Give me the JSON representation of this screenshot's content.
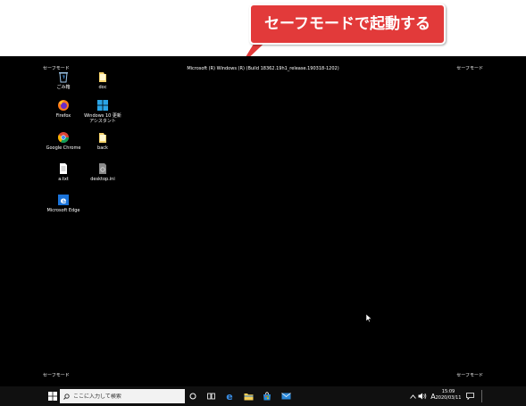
{
  "callout": {
    "text": "セーフモードで起動する"
  },
  "desktop": {
    "build_info": "Microsoft (R) Windows (R) (Build 18362.19h1_release.190318-1202)",
    "corner_labels": {
      "top_left": "セーフモード",
      "top_right": "セーフモード",
      "bottom_left": "セーフモード",
      "bottom_right": "セーフモード"
    },
    "icons": [
      {
        "label": "ごみ箱",
        "icon": "recycle-bin-icon"
      },
      {
        "label": "doc",
        "icon": "folder-icon"
      },
      {
        "label": "Firefox",
        "icon": "firefox-icon"
      },
      {
        "label": "Windows 10 更新アシスタント",
        "icon": "windows-update-assistant-icon"
      },
      {
        "label": "Google Chrome",
        "icon": "chrome-icon"
      },
      {
        "label": "back",
        "icon": "folder-icon"
      },
      {
        "label": "a.txt",
        "icon": "text-file-icon"
      },
      {
        "label": "desktop.ini",
        "icon": "settings-file-icon"
      },
      {
        "label": "Microsoft Edge",
        "icon": "edge-icon"
      }
    ]
  },
  "taskbar": {
    "search_placeholder": "ここに入力して検索",
    "ime_label": "A",
    "clock_time": "15:09",
    "clock_date": "2020/03/11",
    "pinned": [
      "cortana-icon",
      "task-view-icon",
      "edge-icon",
      "file-explorer-icon",
      "store-icon",
      "mail-icon"
    ],
    "tray": [
      "chevron-up-icon",
      "speaker-icon",
      "ime-indicator",
      "notification-icon"
    ]
  },
  "colors": {
    "desktop_bg": "#000000",
    "callout_bg": "#e23a3a",
    "taskbar_bg": "#101010"
  }
}
